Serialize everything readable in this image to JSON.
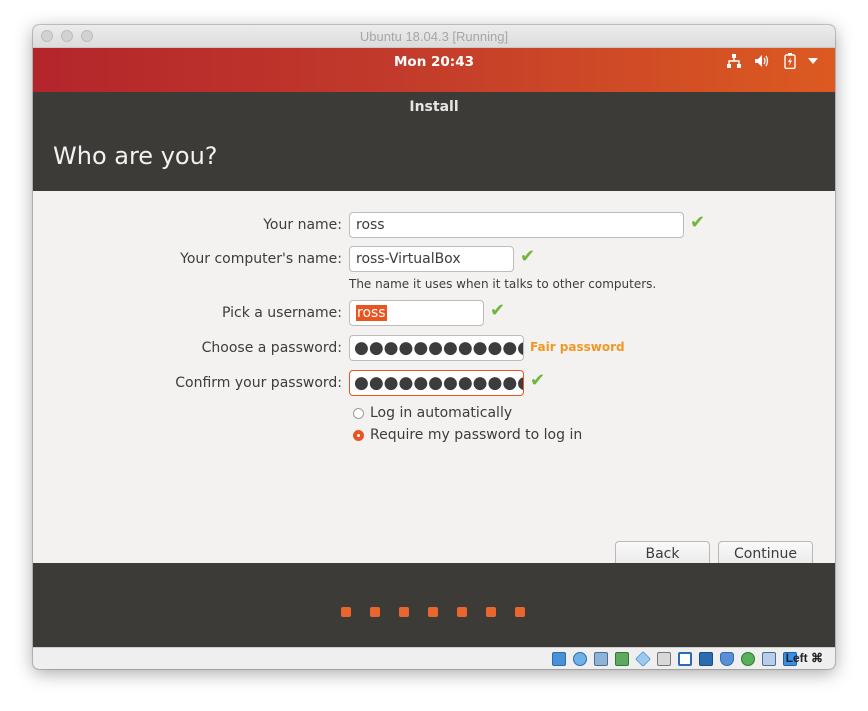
{
  "window": {
    "title": "Ubuntu 18.04.3 [Running]"
  },
  "topbar": {
    "clock": "Mon 20:43",
    "icons": [
      "network-icon",
      "volume-icon",
      "battery-icon",
      "menu-arrow-icon"
    ]
  },
  "installer": {
    "header": "Install",
    "page_title": "Who are you?",
    "fields": {
      "name": {
        "label": "Your name:",
        "value": "ross"
      },
      "computer": {
        "label": "Your computer's name:",
        "value": "ross-VirtualBox",
        "hint": "The name it uses when it talks to other computers."
      },
      "username": {
        "label": "Pick a username:",
        "value": "ross"
      },
      "password": {
        "label": "Choose a password:",
        "value": "●●●●●●●●●●●●●",
        "strength": "Fair password"
      },
      "confirm": {
        "label": "Confirm your password:",
        "value": "●●●●●●●●●●●●●"
      }
    },
    "login_options": {
      "auto": "Log in automatically",
      "require": "Require my password to log in",
      "selected": "require"
    },
    "buttons": {
      "back": "Back",
      "continue": "Continue"
    },
    "progress": {
      "steps": 7
    }
  },
  "vbox": {
    "host_key": "Left ⌘"
  },
  "colors": {
    "accent": "#e95420",
    "ok": "#73b43a",
    "warn": "#f29724",
    "header_bg": "#3d3b38"
  }
}
